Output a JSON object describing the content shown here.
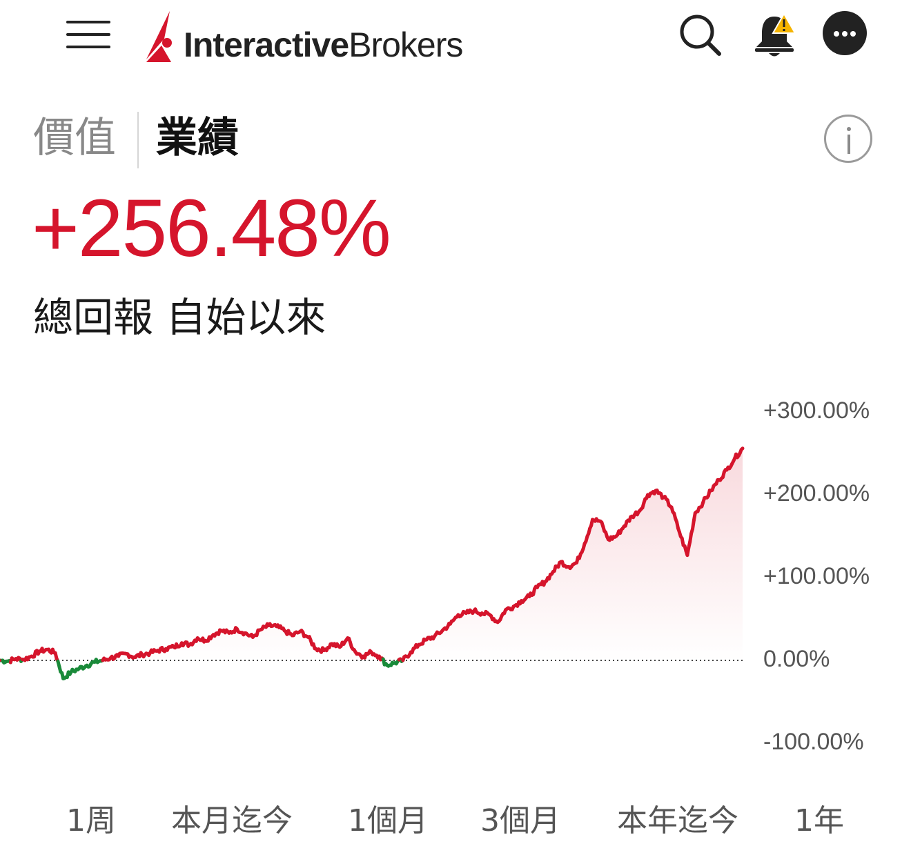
{
  "header": {
    "logo_bold": "Interactive",
    "logo_regular": "Brokers",
    "brand_color": "#d5152c",
    "icons": [
      "menu-icon",
      "search-icon",
      "bell-alert-icon",
      "more-icon"
    ]
  },
  "tabs": {
    "value_label": "價值",
    "performance_label": "業績",
    "active": "performance"
  },
  "summary": {
    "total_return": "+256.48%",
    "caption": "總回報 自始以來",
    "positive_color": "#d5152c",
    "negative_color": "#1a8a3a"
  },
  "chart_data": {
    "type": "line",
    "y_tick_labels": [
      "+300.00%",
      "+200.00%",
      "+100.00%",
      "0.00%",
      "-100.00%"
    ],
    "ylim": [
      -100,
      300
    ],
    "baseline": 0,
    "grid": false,
    "series": [
      {
        "values": [
          0,
          -1,
          2,
          1,
          5,
          11,
          13,
          9,
          -22,
          -14,
          -10,
          -6,
          -2,
          0,
          3,
          5,
          8,
          4,
          7,
          9,
          12,
          14,
          16,
          21,
          19,
          27,
          24,
          31,
          36,
          33,
          38,
          33,
          28,
          37,
          42,
          41,
          36,
          30,
          35,
          28,
          14,
          12,
          20,
          16,
          27,
          10,
          5,
          10,
          5,
          -6,
          -3,
          0,
          10,
          19,
          25,
          29,
          36,
          44,
          55,
          57,
          60,
          57,
          55,
          46,
          61,
          65,
          72,
          77,
          88,
          95,
          107,
          119,
          113,
          118,
          141,
          170,
          168,
          146,
          150,
          162,
          174,
          181,
          200,
          205,
          197,
          185,
          155,
          127,
          178,
          191,
          205,
          218,
          230,
          244,
          256
        ]
      }
    ]
  },
  "ranges": {
    "items": [
      "1周",
      "本月迄今",
      "1個月",
      "3個月",
      "本年迄今",
      "1年"
    ]
  }
}
